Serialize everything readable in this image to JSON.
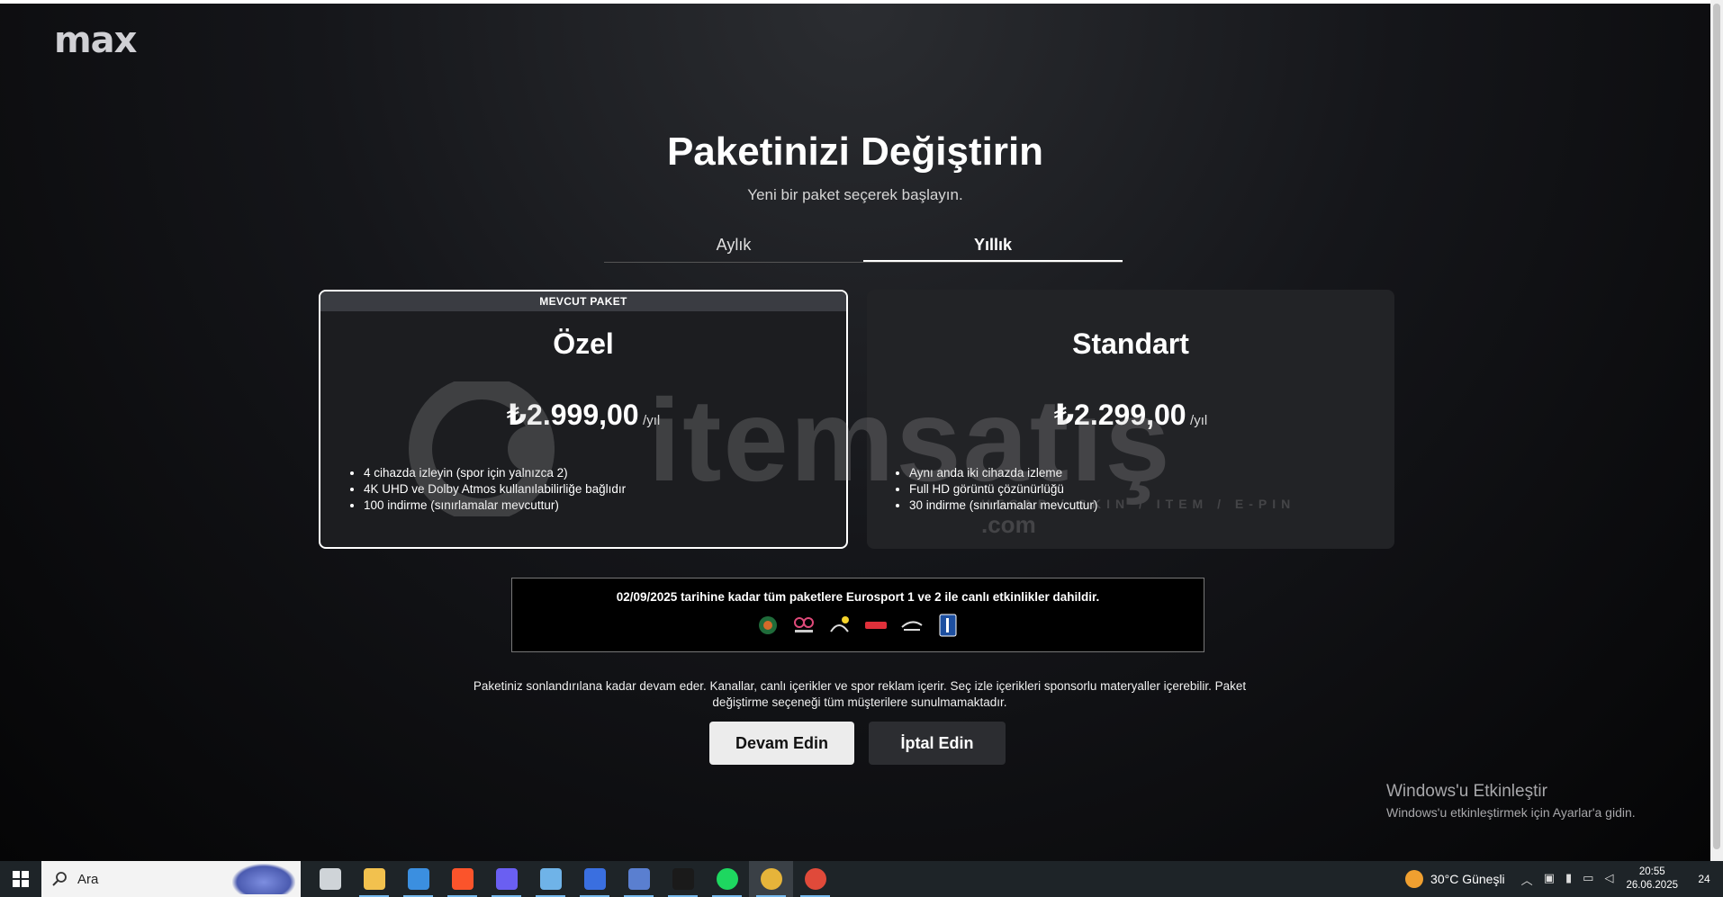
{
  "brand": {
    "logo": "max"
  },
  "header": {
    "title": "Paketinizi Değiştirin",
    "subtitle": "Yeni bir paket seçerek başlayın."
  },
  "tabs": [
    {
      "label": "Aylık",
      "active": false
    },
    {
      "label": "Yıllık",
      "active": true
    }
  ],
  "plans": [
    {
      "badge": "MEVCUT PAKET",
      "name": "Özel",
      "price": "₺2.999,00",
      "period": "/yıl",
      "features": [
        "4 cihazda izleyin (spor için yalnızca 2)",
        "4K UHD ve Dolby Atmos kullanılabilirliğe bağlıdır",
        "100 indirme (sınırlamalar mevcuttur)"
      ]
    },
    {
      "name": "Standart",
      "price": "₺2.299,00",
      "period": "/yıl",
      "features": [
        "Aynı anda iki cihazda izleme",
        "Full HD görüntü çözünürlüğü",
        "30 indirme (sınırlamalar mevcuttur)"
      ]
    }
  ],
  "watermark": {
    "text": "itemsatış",
    "sub": "HESAP / SKIN / ITEM / E-PIN",
    "tld": ".com"
  },
  "promo": {
    "text": "02/09/2025 tarihine kadar tüm paketlere Eurosport 1 ve 2 ile canlı etkinlikler dahildir.",
    "logos": [
      "roland-garros-logo",
      "giro-ditalia-logo",
      "tour-de-france-logo",
      "laliga-logo",
      "us-open-logo",
      "pga-tour-logo"
    ]
  },
  "disclaimer": "Paketiniz sonlandırılana kadar devam eder. Kanallar, canlı içerikler ve spor reklam içerir. Seç izle içerikleri sponsorlu materyaller içerebilir. Paket değiştirme seçeneği tüm müşterilere sunulmamaktadır.",
  "buttons": {
    "continue": "Devam Edin",
    "cancel": "İptal Edin"
  },
  "activation": {
    "title": "Windows'u Etkinleştir",
    "subtitle": "Windows'u etkinleştirmek için Ayarlar'a gidin."
  },
  "taskbar": {
    "search_placeholder": "Ara",
    "apps": [
      {
        "name": "task-view-icon",
        "color": "#cfd4d8"
      },
      {
        "name": "file-explorer-icon",
        "color": "#f2c14e"
      },
      {
        "name": "microsoft-store-icon",
        "color": "#3b8fe0"
      },
      {
        "name": "brave-browser-icon",
        "color": "#fb542b"
      },
      {
        "name": "discord-icon",
        "color": "#6a5ff2"
      },
      {
        "name": "network-app-icon",
        "color": "#6fb3e8"
      },
      {
        "name": "intellij-icon",
        "color": "#3a6fe0"
      },
      {
        "name": "remote-desktop-icon",
        "color": "#5a7fd0"
      },
      {
        "name": "pycharm-icon",
        "color": "#1a1a1a"
      },
      {
        "name": "spotify-icon",
        "color": "#1ed760"
      },
      {
        "name": "chrome-profile-icon",
        "color": "#e6b43a"
      },
      {
        "name": "chrome-icon",
        "color": "#e04a3a"
      }
    ],
    "weather": "30°C  Güneşli",
    "time": "20:55",
    "date": "26.06.2025",
    "notification_count": "24"
  }
}
